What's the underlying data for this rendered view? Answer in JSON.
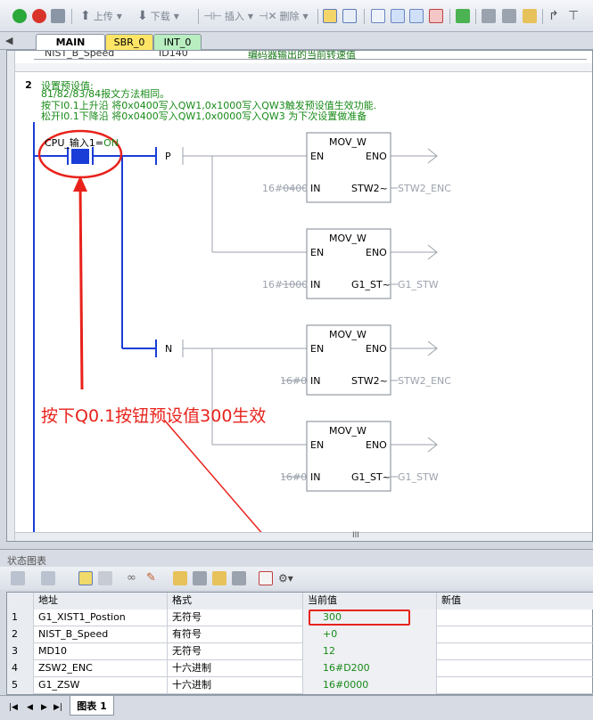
{
  "toolbar": {
    "upload_label": "上传",
    "download_label": "下载",
    "insert_label": "插入",
    "delete_label": "删除"
  },
  "tabs": [
    {
      "label": "MAIN",
      "color": "#ffffff",
      "active": true
    },
    {
      "label": "SBR_0",
      "color": "#ffe566",
      "active": false
    },
    {
      "label": "INT_0",
      "color": "#b8eec0",
      "active": false
    }
  ],
  "symbol_row": {
    "name": "NIST_B_Speed",
    "address": "ID140",
    "comment": "编码器输出的当前转速值"
  },
  "network": {
    "number": "2",
    "title": "设置预设值:",
    "comments": [
      "81/82/83/84报文方法相同。",
      "按下I0.1上升沿 将0x0400写入QW1,0x1000写入QW3触发预设值生效功能.",
      "松开I0.1下降沿 将0x0400写入QW1,0x0000写入QW3 为下次设置做准备"
    ],
    "contact_label": "CPU_输入1=",
    "contact_state": "ON",
    "edge_p": "P",
    "edge_n": "N",
    "boxes": [
      {
        "name": "MOV_W",
        "en": "EN",
        "eno": "ENO",
        "in_pin": "IN",
        "in_value": "16#0400",
        "out_pin": "STW2~",
        "out_value": "STW2_ENC"
      },
      {
        "name": "MOV_W",
        "en": "EN",
        "eno": "ENO",
        "in_pin": "IN",
        "in_value": "16#1000",
        "out_pin": "G1_ST~",
        "out_value": "G1_STW"
      },
      {
        "name": "MOV_W",
        "en": "EN",
        "eno": "ENO",
        "in_pin": "IN",
        "in_value": "16#0",
        "out_pin": "STW2~",
        "out_value": "STW2_ENC"
      },
      {
        "name": "MOV_W",
        "en": "EN",
        "eno": "ENO",
        "in_pin": "IN",
        "in_value": "16#0",
        "out_pin": "G1_ST~",
        "out_value": "G1_STW"
      }
    ]
  },
  "annotation": {
    "text": "按下Q0.1按钮预设值300生效",
    "color": "#e8221b"
  },
  "scroll_label": "III",
  "status_panel": {
    "title": "状态图表",
    "columns": [
      "地址",
      "格式",
      "当前值",
      "新值"
    ],
    "rows": [
      {
        "no": "1",
        "address": "G1_XIST1_Postion",
        "format": "无符号",
        "current": "300",
        "new": ""
      },
      {
        "no": "2",
        "address": "NIST_B_Speed",
        "format": "有符号",
        "current": "+0",
        "new": ""
      },
      {
        "no": "3",
        "address": "MD10",
        "format": "无符号",
        "current": "12",
        "new": ""
      },
      {
        "no": "4",
        "address": "ZSW2_ENC",
        "format": "十六进制",
        "current": "16#D200",
        "new": ""
      },
      {
        "no": "5",
        "address": "G1_ZSW",
        "format": "十六进制",
        "current": "16#0000",
        "new": ""
      }
    ]
  },
  "bottom_tab": "图表 1"
}
